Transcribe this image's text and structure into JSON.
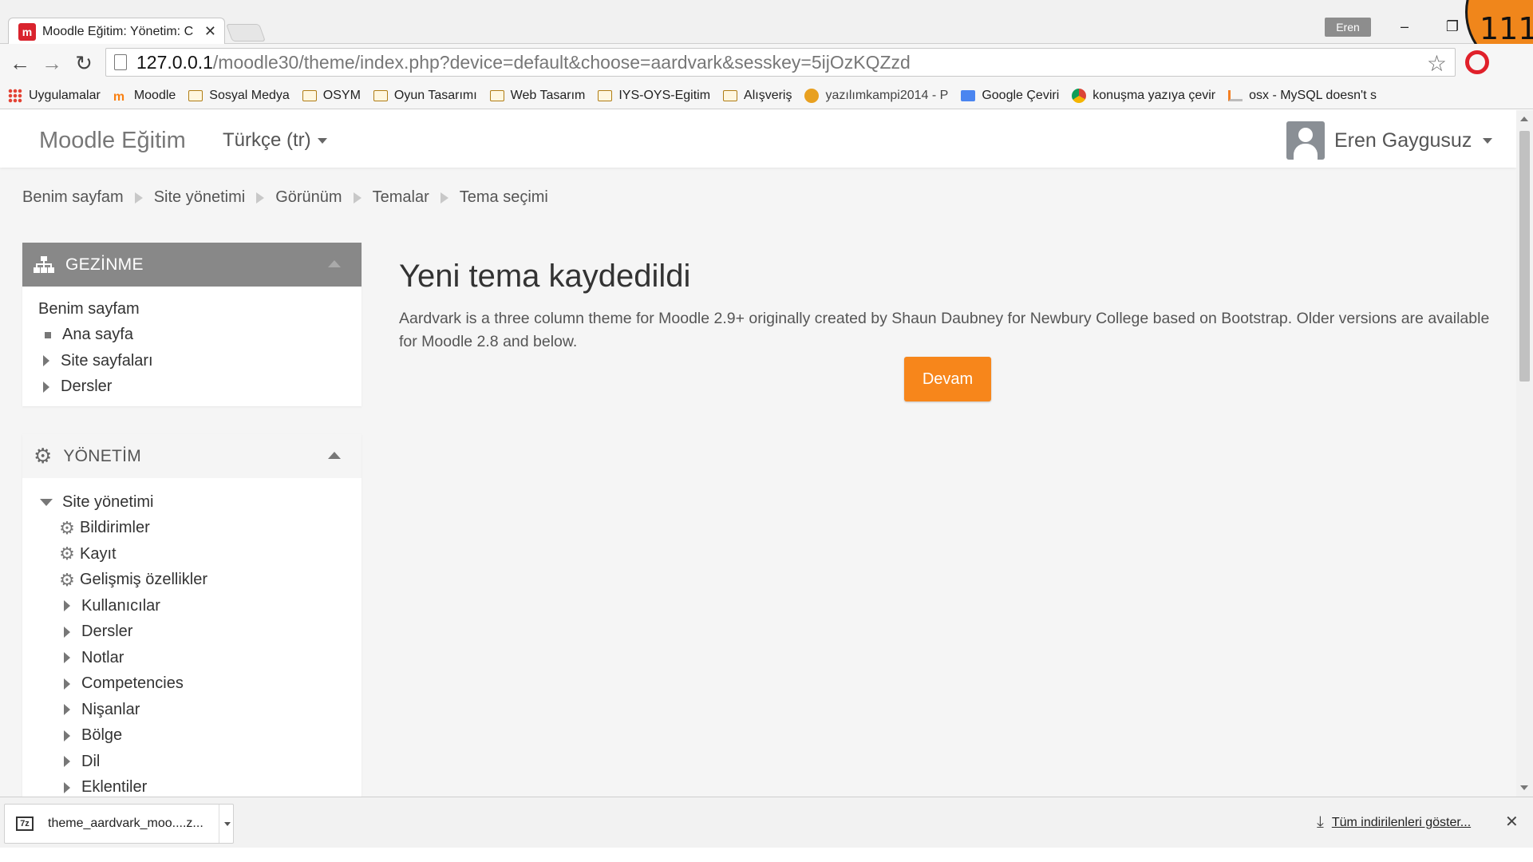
{
  "browser": {
    "tab_title": "Moodle Eğitim: Yönetim: C",
    "tab_favicon": "m",
    "profile_name": "Eren",
    "url_host": "127.0.0.1",
    "url_path": "/moodle30/theme/index.php?device=default&choose=aardvark&sesskey=5ijOzKQZzd",
    "corner_number": "111",
    "bookmarks": [
      {
        "label": "Uygulamalar",
        "icon": "apps-icon"
      },
      {
        "label": "Moodle",
        "icon": "moodle-icon"
      },
      {
        "label": "Sosyal Medya",
        "icon": "folder-icon"
      },
      {
        "label": "OSYM",
        "icon": "folder-icon"
      },
      {
        "label": "Oyun Tasarımı",
        "icon": "folder-icon"
      },
      {
        "label": "Web Tasarım",
        "icon": "folder-icon"
      },
      {
        "label": "IYS-OYS-Egitim",
        "icon": "folder-icon"
      },
      {
        "label": "Alışveriş",
        "icon": "folder-icon"
      },
      {
        "label": "yazılımkampi2014 - P",
        "icon": "tiger-icon"
      },
      {
        "label": "Google Çeviri",
        "icon": "translate-icon"
      },
      {
        "label": "konuşma yazıya çevir",
        "icon": "chrome-icon"
      },
      {
        "label": "osx - MySQL doesn't s",
        "icon": "stackoverflow-icon"
      }
    ]
  },
  "navbar": {
    "brand": "Moodle Eğitim",
    "language": "Türkçe (tr)",
    "user_name": "Eren Gaygusuz"
  },
  "breadcrumb": [
    "Benim sayfam",
    "Site yönetimi",
    "Görünüm",
    "Temalar",
    "Tema seçimi"
  ],
  "navigation_block": {
    "title": "GEZİNME",
    "root": "Benim sayfam",
    "items": [
      "Ana sayfa",
      "Site sayfaları",
      "Dersler"
    ]
  },
  "admin_block": {
    "title": "YÖNETİM",
    "root": "Site yönetimi",
    "gear_items": [
      "Bildirimler",
      "Kayıt",
      "Gelişmiş özellikler"
    ],
    "items": [
      "Kullanıcılar",
      "Dersler",
      "Notlar",
      "Competencies",
      "Nişanlar",
      "Bölge",
      "Dil",
      "Eklentiler"
    ]
  },
  "main": {
    "heading": "Yeni tema kaydedildi",
    "description": "Aardvark is a three column theme for Moodle 2.9+ originally created by Shaun Daubney for Newbury College based on Bootstrap. Older versions are available for Moodle 2.8 and below.",
    "continue_label": "Devam"
  },
  "downloads": {
    "file_name": "theme_aardvark_moo....z...",
    "show_all_label": "Tüm indirilenleri göster..."
  },
  "colors": {
    "accent": "#f7861b",
    "nav_block_header": "#888888"
  }
}
